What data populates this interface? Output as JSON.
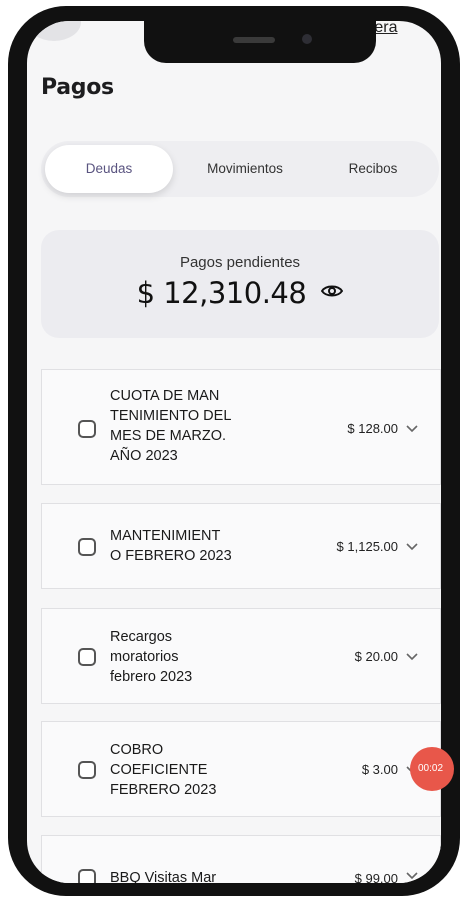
{
  "header": {
    "top_link": "etera",
    "title": "Pagos"
  },
  "tabs": [
    {
      "label": "Deudas",
      "active": true
    },
    {
      "label": "Movimientos",
      "active": false
    },
    {
      "label": "Recibos",
      "active": false
    }
  ],
  "summary": {
    "label": "Pagos pendientes",
    "amount": "$ 12,310.48",
    "visibility_icon": "eye-icon"
  },
  "debts": [
    {
      "description": "CUOTA DE MAN TENIMIENTO DEL MES DE MARZO. AÑO 2023",
      "lines": [
        "CUOTA DE MAN",
        "TENIMIENTO DEL",
        "MES DE MARZO.",
        "AÑO 2023"
      ],
      "amount": "$ 128.00",
      "checked": false
    },
    {
      "description": "MANTENIMIENTO FEBRERO 2023",
      "lines": [
        "MANTENIMIENT",
        "O FEBRERO 2023"
      ],
      "amount": "$ 1,125.00",
      "checked": false
    },
    {
      "description": "Recargos moratorios febrero 2023",
      "lines": [
        "Recargos",
        "moratorios",
        "febrero 2023"
      ],
      "amount": "$ 20.00",
      "checked": false
    },
    {
      "description": "COBRO COEFICIENTE FEBRERO 2023",
      "lines": [
        "COBRO",
        "COEFICIENTE",
        "FEBRERO 2023"
      ],
      "amount": "$ 3.00",
      "checked": false
    },
    {
      "description": "BBQ Visitas Mar",
      "lines": [
        "BBQ Visitas Mar"
      ],
      "amount": "$ 99.00",
      "checked": false
    }
  ],
  "recording_badge": "00:02",
  "colors": {
    "active_tab_text": "#5a5480",
    "badge": "#e8574a",
    "screen_bg": "#f6f6f7"
  }
}
